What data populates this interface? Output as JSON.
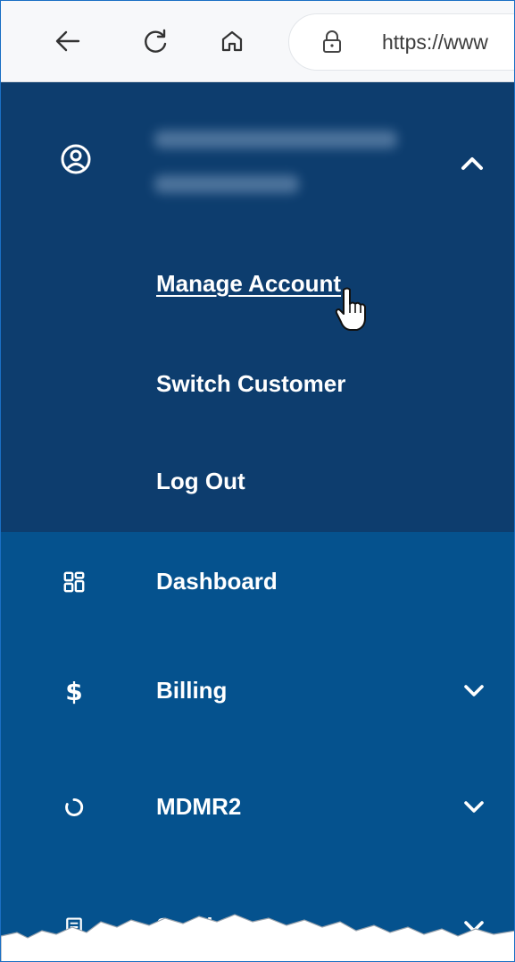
{
  "browser": {
    "url": "https://www"
  },
  "account_menu": {
    "items": [
      {
        "label": "Manage Account"
      },
      {
        "label": "Switch Customer"
      },
      {
        "label": "Log Out"
      }
    ]
  },
  "nav": {
    "items": [
      {
        "label": "Dashboard",
        "icon": "dashboard-icon"
      },
      {
        "label": "Billing",
        "icon": "dollar-icon"
      },
      {
        "label": "MDMR2",
        "icon": "circle-icon"
      },
      {
        "label": "Services",
        "icon": "document-icon"
      }
    ]
  },
  "colors": {
    "account_bg": "#0d3d6e",
    "nav_bg": "#05528e",
    "text": "#ffffff"
  }
}
